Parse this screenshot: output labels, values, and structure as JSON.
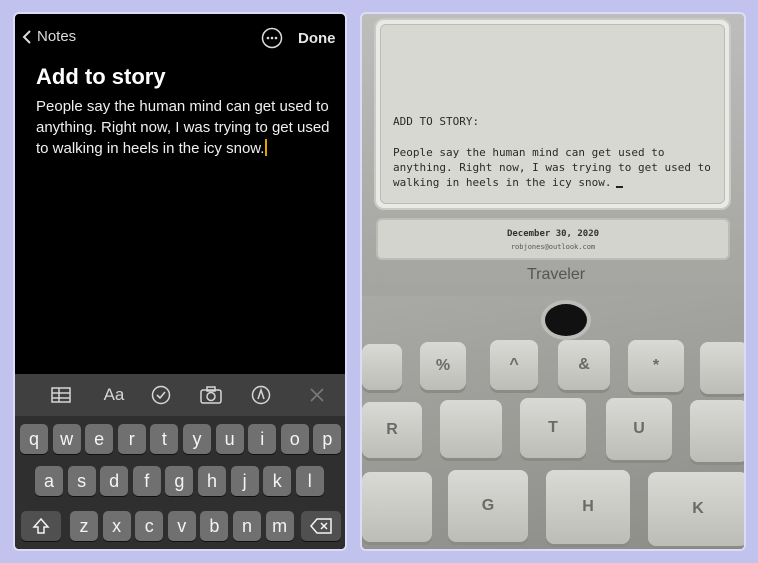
{
  "phone": {
    "nav": {
      "back_label": "Notes",
      "done_label": "Done",
      "more_icon": "ellipsis-circle-icon"
    },
    "note": {
      "title": "Add to story",
      "body": "People say the human mind can get used to anything. Right now, I was trying to get used to walking in heels in the icy snow."
    },
    "toolbar": {
      "format_label": "Aa",
      "icons": [
        "table-icon",
        "text-format-icon",
        "checklist-icon",
        "camera-icon",
        "markup-pen-icon",
        "close-icon"
      ]
    },
    "keyboard": {
      "row1": [
        "q",
        "w",
        "e",
        "r",
        "t",
        "y",
        "u",
        "i",
        "o",
        "p"
      ],
      "row2": [
        "a",
        "s",
        "d",
        "f",
        "g",
        "h",
        "j",
        "k",
        "l"
      ],
      "row3": [
        "z",
        "x",
        "c",
        "v",
        "b",
        "n",
        "m"
      ],
      "shift_icon": "shift-icon",
      "delete_icon": "delete-icon"
    }
  },
  "photo": {
    "screen": {
      "heading": "ADD TO STORY:",
      "body": "People say the human mind can get used to anything. Right now, I was trying to get used to walking in heels in the icy snow."
    },
    "status": {
      "date": "December 30, 2020",
      "email": "robjones@outlook.com"
    },
    "brand": "Traveler",
    "keys": [
      "%",
      "^",
      "&",
      "*",
      "R",
      "T",
      "U",
      "G",
      "H",
      "K"
    ]
  },
  "colors": {
    "background": "#c2c2ee",
    "phone_bg": "#000000",
    "caret": "#e2a300",
    "key": "#707070"
  }
}
